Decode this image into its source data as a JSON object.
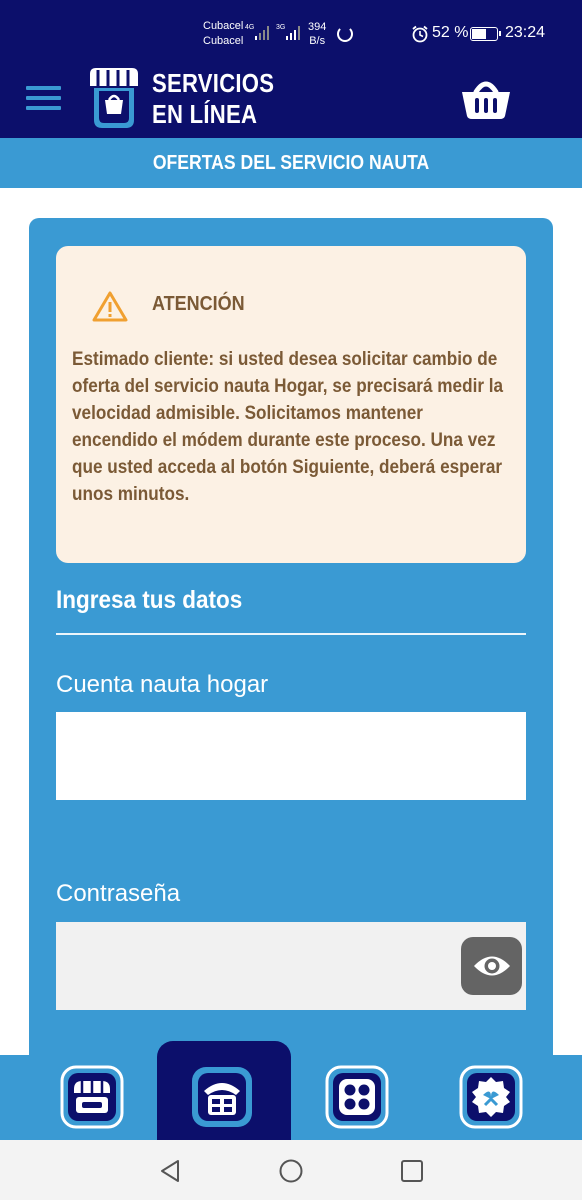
{
  "status_bar": {
    "carrier_1": "Cubacel",
    "carrier_2": "Cubacel",
    "network_1": "4G",
    "network_2": "3G",
    "speed_value": "394",
    "speed_unit": "B/s",
    "battery": "52 %",
    "time": "23:24"
  },
  "header": {
    "logo_line1": "SERVICIOS",
    "logo_line2": "EN LÍNEA"
  },
  "banner": {
    "title": "OFERTAS DEL SERVICIO NAUTA"
  },
  "alert": {
    "title": "ATENCIÓN",
    "body": "Estimado cliente: si usted desea solicitar cambio de oferta del servicio nauta Hogar, se precisará medir la velocidad admisible. Solicitamos mantener encendido el módem durante este proceso. Una vez que usted acceda al botón Siguiente, deberá esperar unos minutos."
  },
  "form": {
    "section_title": "Ingresa tus datos",
    "account_label": "Cuenta nauta hogar",
    "account_value": "",
    "password_label": "Contraseña",
    "password_value": ""
  },
  "colors": {
    "navy": "#0c0f6b",
    "blue": "#3a9ad3",
    "alert_bg": "#fcf1e4",
    "alert_text": "#7b5a36",
    "warning": "#f0a030"
  },
  "bottom_nav": {
    "items": [
      "shop-icon",
      "phone-icon",
      "apps-icon",
      "gift-icon"
    ],
    "active": "phone-icon"
  }
}
